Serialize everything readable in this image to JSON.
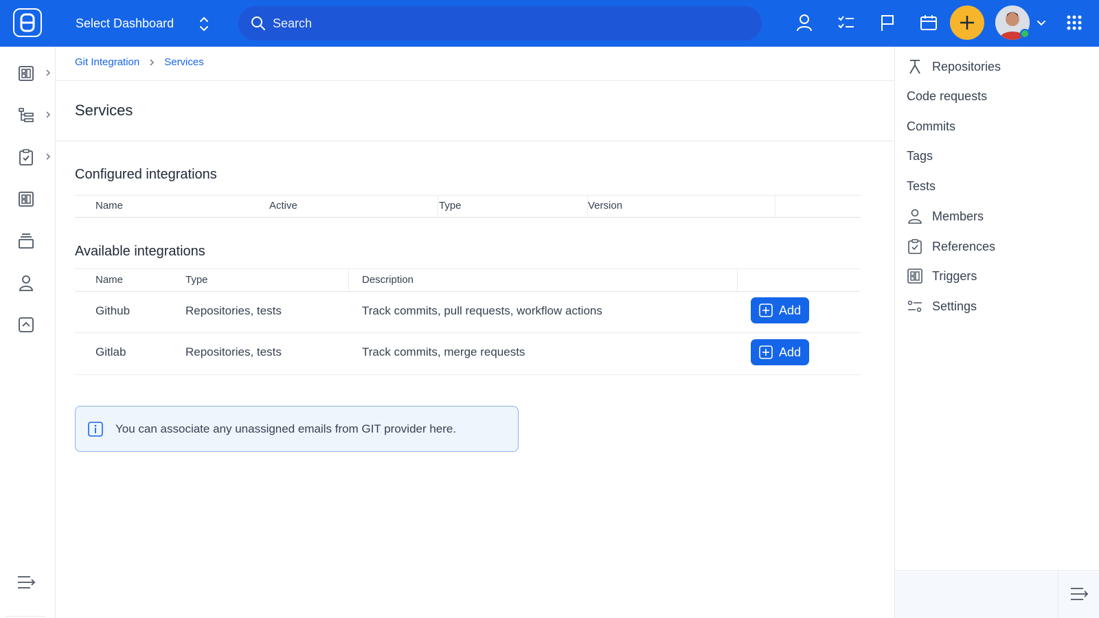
{
  "topbar": {
    "logo_icon": "app-logo",
    "dashboard_select_label": "Select Dashboard",
    "search_placeholder": "Search",
    "icons": [
      "user-icon",
      "tasks-icon",
      "flag-icon",
      "calendar-icon",
      "plus-icon",
      "avatar",
      "chevron-down-icon",
      "apps-grid-icon"
    ],
    "accent_color": "#1565e9",
    "plus_color": "#f6b52b",
    "status_color": "#2fc25b"
  },
  "leftbar": {
    "items": [
      {
        "icon": "dashboard-icon",
        "has_arrow": true
      },
      {
        "icon": "tree-list-icon",
        "has_arrow": true
      },
      {
        "icon": "clipboard-check-icon",
        "has_arrow": true
      },
      {
        "icon": "board-icon",
        "has_arrow": false
      },
      {
        "icon": "stack-icon",
        "has_arrow": false
      },
      {
        "icon": "person-icon",
        "has_arrow": false
      },
      {
        "icon": "chevron-up-box-icon",
        "has_arrow": false
      }
    ],
    "collapse_icon": "collapse-menu-icon"
  },
  "breadcrumb": {
    "items": [
      "Git Integration",
      "Services"
    ]
  },
  "main": {
    "title": "Services",
    "configured": {
      "title": "Configured integrations",
      "columns": [
        "Name",
        "Active",
        "Type",
        "Version"
      ],
      "rows": []
    },
    "available": {
      "title": "Available integrations",
      "columns": [
        "Name",
        "Type",
        "Description"
      ],
      "rows": [
        {
          "name": "Github",
          "type": "Repositories, tests",
          "description": "Track commits, pull requests, workflow actions",
          "action": "Add"
        },
        {
          "name": "Gitlab",
          "type": "Repositories, tests",
          "description": "Track commits, merge requests",
          "action": "Add"
        }
      ]
    },
    "info_text": "You can associate any unassigned emails from GIT provider here."
  },
  "rightpanel": {
    "items": [
      {
        "label": "Repositories",
        "icon": "merge-icon"
      },
      {
        "label": "Code requests",
        "icon": ""
      },
      {
        "label": "Commits",
        "icon": ""
      },
      {
        "label": "Tags",
        "icon": ""
      },
      {
        "label": "Tests",
        "icon": ""
      },
      {
        "label": "Members",
        "icon": "person-icon"
      },
      {
        "label": "References",
        "icon": "clipboard-check-icon"
      },
      {
        "label": "Triggers",
        "icon": "board-icon"
      },
      {
        "label": "Settings",
        "icon": "sliders-icon"
      }
    ],
    "collapse_icon": "collapse-menu-icon"
  }
}
